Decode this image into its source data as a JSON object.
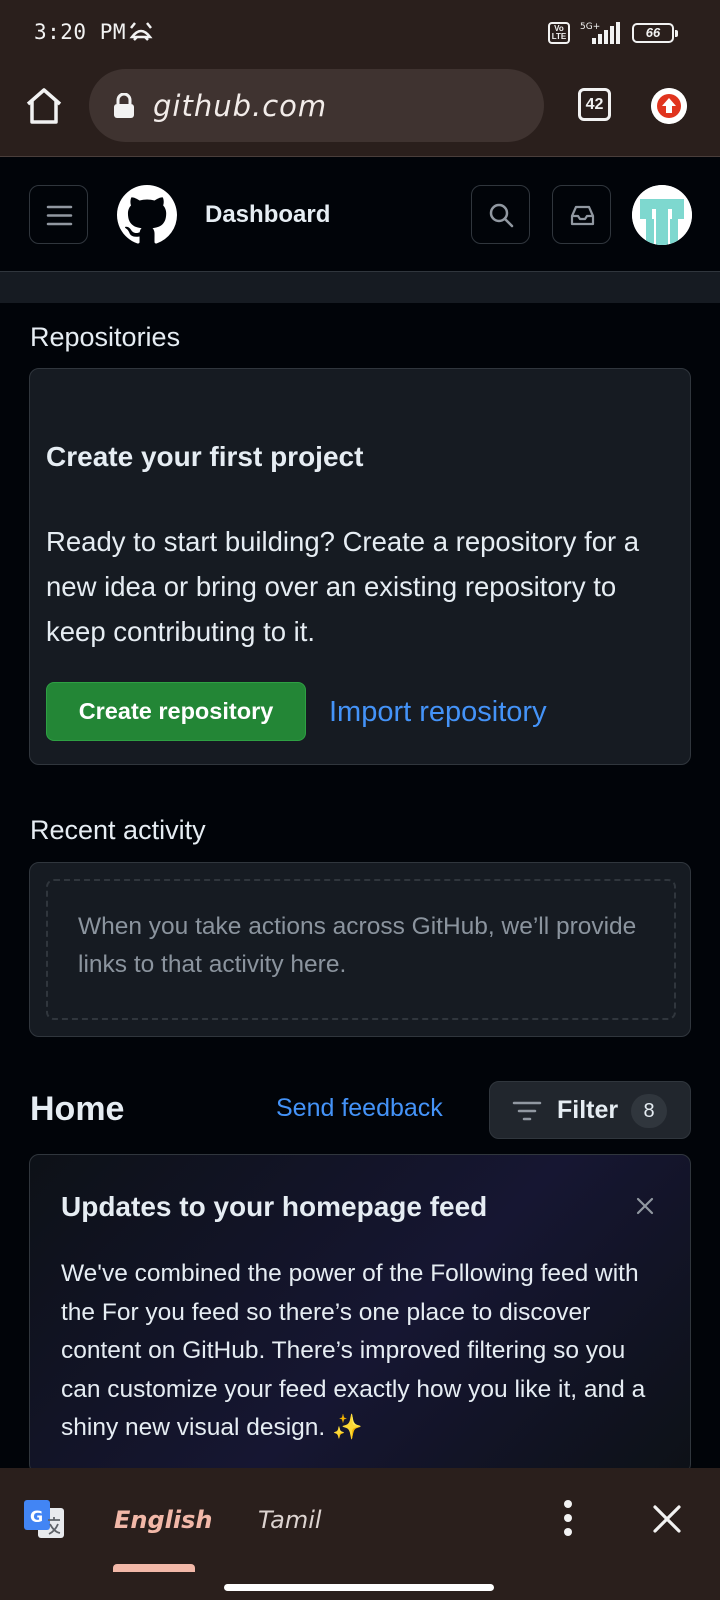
{
  "status_bar": {
    "time": "3:20 PM",
    "network": "5G+",
    "volte": "Vo LTE",
    "battery": "66"
  },
  "browser": {
    "url": "github.com",
    "tab_count": "42"
  },
  "header": {
    "title": "Dashboard"
  },
  "repositories": {
    "section_title": "Repositories",
    "card_heading": "Create your first project",
    "card_body": "Ready to start building? Create a repository for a new idea or bring over an existing repository to keep contributing to it.",
    "create_button": "Create repository",
    "import_link": "Import repository"
  },
  "recent_activity": {
    "section_title": "Recent activity",
    "empty_text": "When you take actions across GitHub, we’ll provide links to that activity here."
  },
  "home": {
    "title": "Home",
    "feedback_link": "Send feedback",
    "filter_label": "Filter",
    "filter_count": "8"
  },
  "feed_update": {
    "heading": "Updates to your homepage feed",
    "body": "We've combined the power of the Following feed with the For you feed so there’s one place to discover content on GitHub. There’s improved filtering so you can customize your feed exactly how you like it, and a shiny new visual design. ✨"
  },
  "translate_bar": {
    "source_language": "English",
    "target_language": "Tamil"
  },
  "colors": {
    "accent_green": "#238636",
    "link_blue": "#4493f8",
    "chrome_brown": "#2a1f1c",
    "page_bg": "#010409"
  }
}
